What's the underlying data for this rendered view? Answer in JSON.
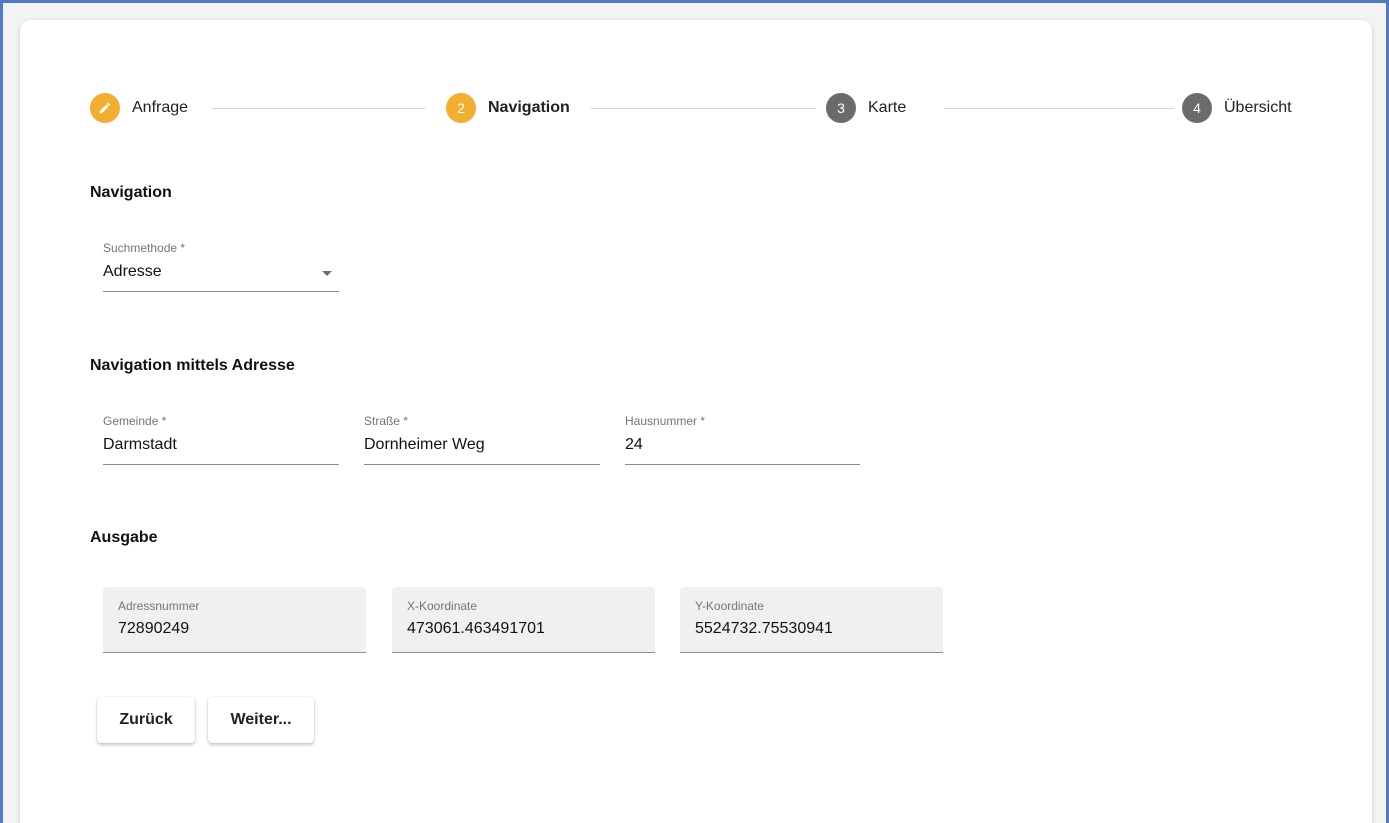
{
  "stepper": {
    "steps": [
      {
        "number": "",
        "label": "Anfrage",
        "state": "done",
        "icon": "pencil-icon"
      },
      {
        "number": "2",
        "label": "Navigation",
        "state": "active"
      },
      {
        "number": "3",
        "label": "Karte",
        "state": "inactive"
      },
      {
        "number": "4",
        "label": "Übersicht",
        "state": "inactive"
      }
    ]
  },
  "navigation": {
    "title": "Navigation",
    "search_method": {
      "label": "Suchmethode *",
      "value": "Adresse"
    }
  },
  "address": {
    "title": "Navigation mittels Adresse",
    "gemeinde": {
      "label": "Gemeinde *",
      "value": "Darmstadt"
    },
    "strasse": {
      "label": "Straße *",
      "value": "Dornheimer Weg"
    },
    "hausnummer": {
      "label": "Hausnummer *",
      "value": "24"
    }
  },
  "output": {
    "title": "Ausgabe",
    "adressnummer": {
      "label": "Adressnummer",
      "value": "72890249"
    },
    "x_koordinate": {
      "label": "X-Koordinate",
      "value": "473061.463491701"
    },
    "y_koordinate": {
      "label": "Y-Koordinate",
      "value": "5524732.75530941"
    }
  },
  "buttons": {
    "back": "Zurück",
    "next": "Weiter..."
  },
  "colors": {
    "active_step": "#f2ae2e",
    "inactive_step": "#6b6b6b",
    "frame_border": "#4f7bc4"
  }
}
